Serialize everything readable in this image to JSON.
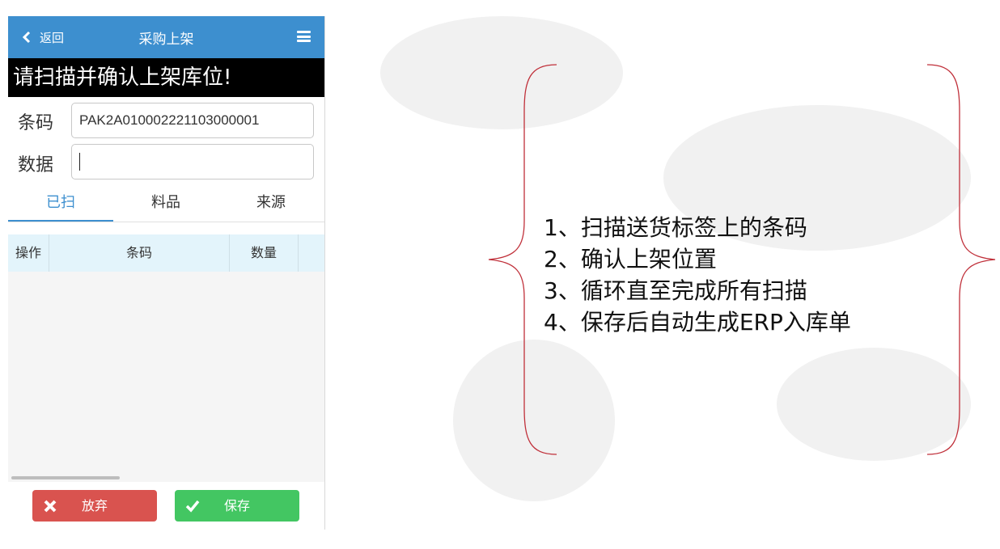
{
  "nav": {
    "back_label": "返回",
    "title": "采购上架",
    "menu_icon": "hamburger-menu-icon",
    "back_icon": "chevron-left-icon"
  },
  "prompt": "请扫描并确认上架库位!",
  "fields": {
    "barcode_label": "条码",
    "barcode_value": "PAK2A010002221103000001",
    "data_label": "数据",
    "data_value": ""
  },
  "tabs": [
    {
      "label": "已扫",
      "active": true
    },
    {
      "label": "料品",
      "active": false
    },
    {
      "label": "来源",
      "active": false
    }
  ],
  "table": {
    "columns": [
      "操作",
      "条码",
      "数量",
      ""
    ],
    "rows": []
  },
  "buttons": {
    "abandon": {
      "label": "放弃",
      "icon": "close-icon",
      "color": "#d9534f"
    },
    "save": {
      "label": "保存",
      "icon": "check-icon",
      "color": "#43c662"
    }
  },
  "colors": {
    "nav_bg": "#3d8fcf",
    "accent": "#3d8fcf",
    "bracket": "#c0303a"
  },
  "steps": [
    "1、扫描送货标签上的条码",
    "2、确认上架位置",
    "3、循环直至完成所有扫描",
    "4、保存后自动生成ERP入库单"
  ]
}
